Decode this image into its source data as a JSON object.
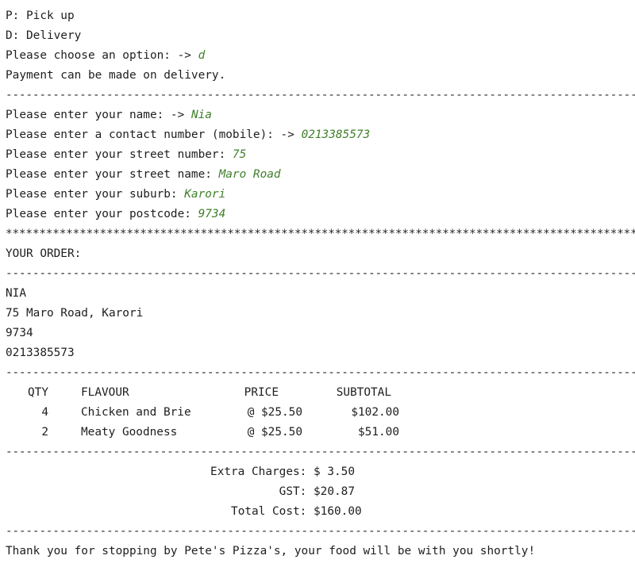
{
  "menu": {
    "option_p": "P: Pick up",
    "option_d": "D: Delivery",
    "choose_prompt": "Please choose an option: -> ",
    "choose_value": "d",
    "payment_note": "Payment can be made on delivery."
  },
  "separator_dash": "-----------------------------------------------------------------------------------------------",
  "separator_star": "***********************************************************************************************",
  "details": [
    {
      "prompt": "Please enter your name: -> ",
      "value": "Nia"
    },
    {
      "prompt": "Please enter a contact number (mobile): -> ",
      "value": "0213385573"
    },
    {
      "prompt": "Please enter your street number: ",
      "value": "75"
    },
    {
      "prompt": "Please enter your street name: ",
      "value": "Maro Road"
    },
    {
      "prompt": "Please enter your suburb: ",
      "value": "Karori"
    },
    {
      "prompt": "Please enter your postcode: ",
      "value": "9734"
    }
  ],
  "order": {
    "heading": "YOUR ORDER:",
    "name": "NIA",
    "address": "75 Maro Road, Karori",
    "postcode": "9734",
    "phone": "0213385573",
    "headers": {
      "qty": "QTY",
      "flavour": "FLAVOUR",
      "price": "PRICE",
      "subtotal": "SUBTOTAL"
    },
    "items": [
      {
        "qty": "4",
        "flavour": "Chicken and Brie",
        "price": "@ $25.50",
        "subtotal": "$102.00"
      },
      {
        "qty": "2",
        "flavour": "Meaty Goodness",
        "price": "@ $25.50",
        "subtotal": "$51.00"
      }
    ],
    "extra_label": "Extra Charges: ",
    "extra_value": "$ 3.50",
    "gst_label": "GST: ",
    "gst_value": "$20.87",
    "total_label": "Total Cost: ",
    "total_value": "$160.00",
    "thank_you": "Thank you for stopping by Pete's Pizza's, your food will be with you shortly!"
  }
}
